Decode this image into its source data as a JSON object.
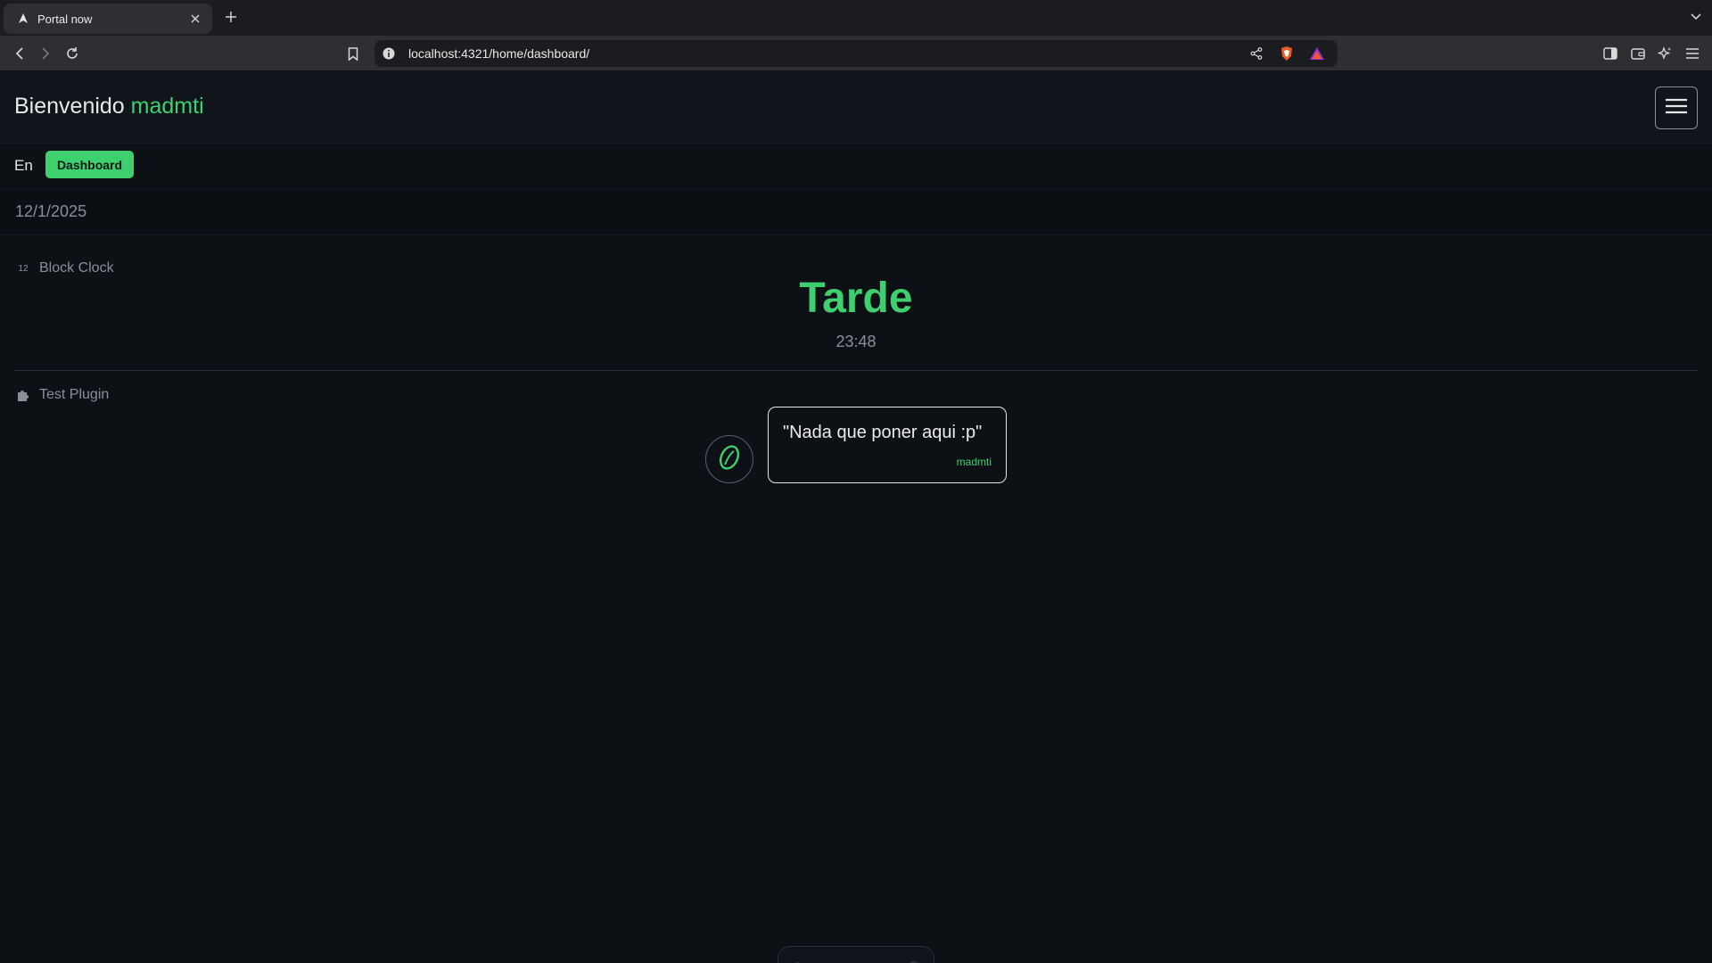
{
  "browser": {
    "tab_title": "Portal now",
    "url": "localhost:4321/home/dashboard/"
  },
  "header": {
    "welcome": "Bienvenido",
    "username": "madmti"
  },
  "nav": {
    "language": "En",
    "dashboard_label": "Dashboard"
  },
  "date": "12/1/2025",
  "block_clock": {
    "icon_text": "12",
    "label": "Block Clock",
    "period": "Tarde",
    "time": "23:48"
  },
  "test_plugin": {
    "label": "Test Plugin",
    "quote": "\"Nada que poner aqui :p\"",
    "author": "madmti"
  },
  "colors": {
    "accent": "#3ecf6e",
    "background": "#0d1116",
    "header_bg": "#10151b"
  },
  "icons": [
    "portal-favicon-icon",
    "close-icon",
    "plus-icon",
    "chevron-down-icon",
    "back-icon",
    "forward-icon",
    "reload-icon",
    "bookmark-icon",
    "info-icon",
    "share-icon",
    "brave-shield-icon",
    "brave-rewards-icon",
    "sidebar-icon",
    "wallet-icon",
    "leo-ai-icon",
    "hamburger-menu-icon",
    "puzzle-icon",
    "portal-logo-icon"
  ]
}
